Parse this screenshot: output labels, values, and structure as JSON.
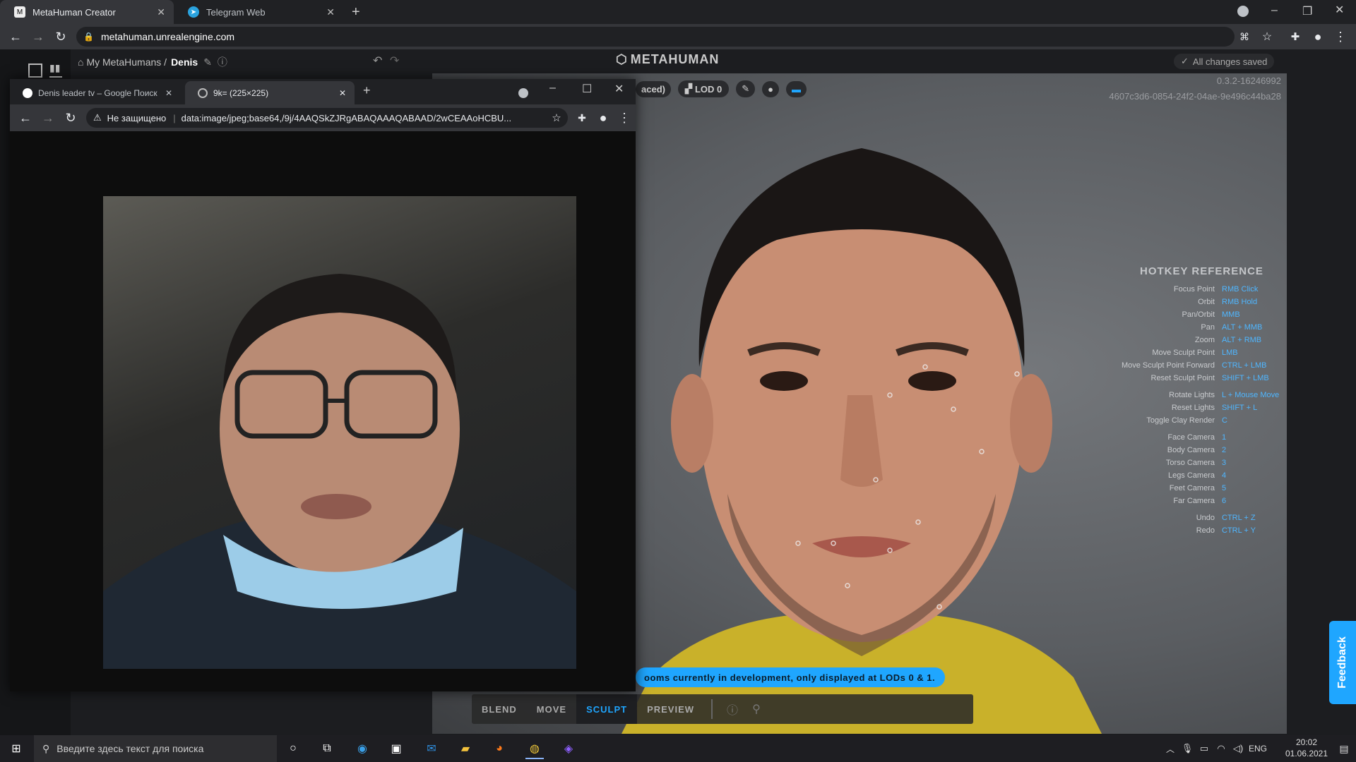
{
  "outer_browser": {
    "tabs": [
      {
        "label": "MetaHuman Creator"
      },
      {
        "label": "Telegram Web"
      }
    ],
    "url": "metahuman.unrealengine.com"
  },
  "app": {
    "breadcrumb_root": "My MetaHumans /",
    "character_name": "Denis",
    "logo": "METAHUMAN",
    "save_status": "All changes saved",
    "version": "0.3.2-16246992",
    "guid": "4607c3d6-0854-24f2-04ae-9e496c44ba28",
    "lod_partial": "aced)",
    "lod_label": "LOD 0",
    "hotkeys_title": "HOTKEY REFERENCE",
    "hotkeys": [
      {
        "k": "Focus Point",
        "v": "RMB Click"
      },
      {
        "k": "Orbit",
        "v": "RMB Hold"
      },
      {
        "k": "Pan/Orbit",
        "v": "MMB"
      },
      {
        "k": "Pan",
        "v": "ALT + MMB"
      },
      {
        "k": "Zoom",
        "v": "ALT + RMB"
      },
      {
        "k": "Move Sculpt Point",
        "v": "LMB"
      },
      {
        "k": "Move Sculpt Point Forward",
        "v": "CTRL + LMB"
      },
      {
        "k": "Reset Sculpt Point",
        "v": "SHIFT + LMB"
      },
      {
        "k": "Rotate Lights",
        "v": "L + Mouse Move"
      },
      {
        "k": "Reset Lights",
        "v": "SHIFT + L"
      },
      {
        "k": "Toggle Clay Render",
        "v": "C"
      },
      {
        "k": "Face Camera",
        "v": "1"
      },
      {
        "k": "Body Camera",
        "v": "2"
      },
      {
        "k": "Torso Camera",
        "v": "3"
      },
      {
        "k": "Legs Camera",
        "v": "4"
      },
      {
        "k": "Feet Camera",
        "v": "5"
      },
      {
        "k": "Far Camera",
        "v": "6"
      },
      {
        "k": "Undo",
        "v": "CTRL + Z"
      },
      {
        "k": "Redo",
        "v": "CTRL + Y"
      }
    ],
    "notice": "ooms currently in development, only displayed at LODs 0 & 1.",
    "modes": [
      "BLEND",
      "MOVE",
      "SCULPT",
      "PREVIEW"
    ],
    "active_mode": "SCULPT",
    "feedback": "Feedback"
  },
  "inner_browser": {
    "tabs": [
      {
        "label": "Denis leader tv – Google Поиск"
      },
      {
        "label": "9k= (225×225)"
      }
    ],
    "security": "Не защищено",
    "url": "data:image/jpeg;base64,/9j/4AAQSkZJRgABAQAAAQABAAD/2wCEAAoHCBU..."
  },
  "taskbar": {
    "search_placeholder": "Введите здесь текст для поиска",
    "lang": "ENG",
    "time": "20:02",
    "date": "01.06.2021"
  },
  "colors": {
    "accent": "#1fa6ff"
  }
}
